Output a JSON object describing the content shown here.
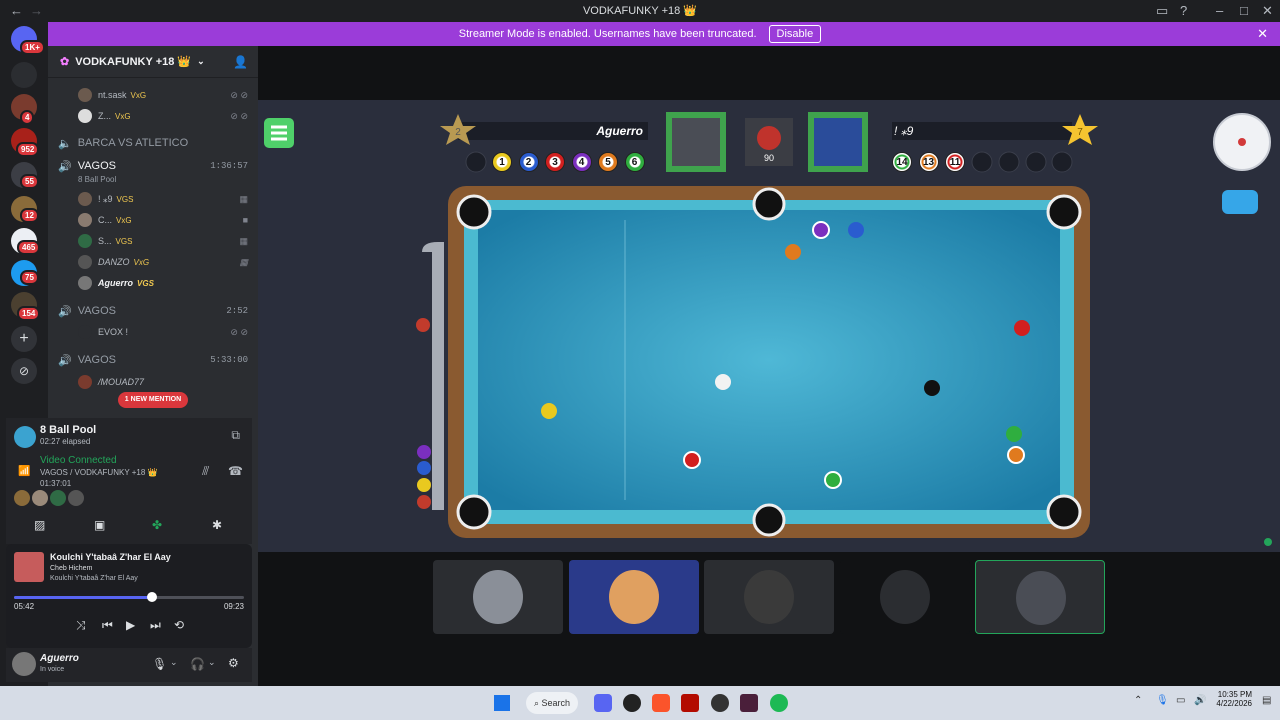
{
  "window": {
    "title": "VODKAFUNKY +18 👑"
  },
  "banner": {
    "text": "Streamer Mode is enabled. Usernames have been truncated.",
    "button": "Disable"
  },
  "rail": {
    "badges": [
      "1K+",
      "4",
      "952",
      "55",
      "12",
      "465",
      "75",
      "154"
    ]
  },
  "guild": {
    "name": "VODKAFUNKY +18 👑"
  },
  "members_top": [
    {
      "name": "nt.sask",
      "tag": "VxG"
    },
    {
      "name": "Z...",
      "tag": "VxG"
    }
  ],
  "channels": {
    "barca": {
      "name": "BARCA VS ATLETICO"
    },
    "vagos1": {
      "name": "VAGOS",
      "time": "1:36:57",
      "activity": "8 Ball Pool"
    },
    "vagos2": {
      "name": "VAGOS",
      "time": "2:52"
    },
    "vagos3": {
      "name": "VAGOS",
      "time": "5:33:00"
    }
  },
  "members_vagos1": [
    {
      "name": "! ⁎9",
      "tag": "VGS"
    },
    {
      "name": "C...",
      "tag": "VxG"
    },
    {
      "name": "S...",
      "tag": "VGS"
    },
    {
      "name": "DANZO",
      "tag": "VxG"
    },
    {
      "name": "Aguerro",
      "tag": "VGS"
    }
  ],
  "members_vagos2": [
    {
      "name": "EVOX !"
    }
  ],
  "members_vagos3": [
    {
      "name": "/MOUAD77"
    }
  ],
  "mention": "1 NEW MENTION",
  "activity": {
    "title": "8 Ball Pool",
    "elapsed": "02:27 elapsed"
  },
  "voice": {
    "status": "Video Connected",
    "channel": "VAGOS / VODKAFUNKY +18 👑",
    "time": "01:37:01"
  },
  "music": {
    "title": "Koulchi Y'tabaâ Z'har El Aay",
    "artist": "Cheb Hichem",
    "album": "Koulchi Y'tabaâ Z'har El Aay",
    "pos": "05:42",
    "dur": "09:23",
    "progress": 0.6
  },
  "user": {
    "name": "Aguerro",
    "status": "In voice"
  },
  "game": {
    "left_player": {
      "name": "Aguerro",
      "level": "2",
      "balls": [
        "1",
        "2",
        "3",
        "4",
        "5",
        "6"
      ]
    },
    "right_player": {
      "name": "! ⁎9",
      "level": "7",
      "balls": [
        "14",
        "13",
        "11"
      ]
    },
    "timer": "90"
  },
  "taskbar": {
    "search": "Search",
    "time": "10:35 PM",
    "date": "4/22/2026"
  },
  "colors": {
    "accent": "#9b3cd9",
    "green": "#23a55a",
    "felt": "#2d9ac0"
  }
}
